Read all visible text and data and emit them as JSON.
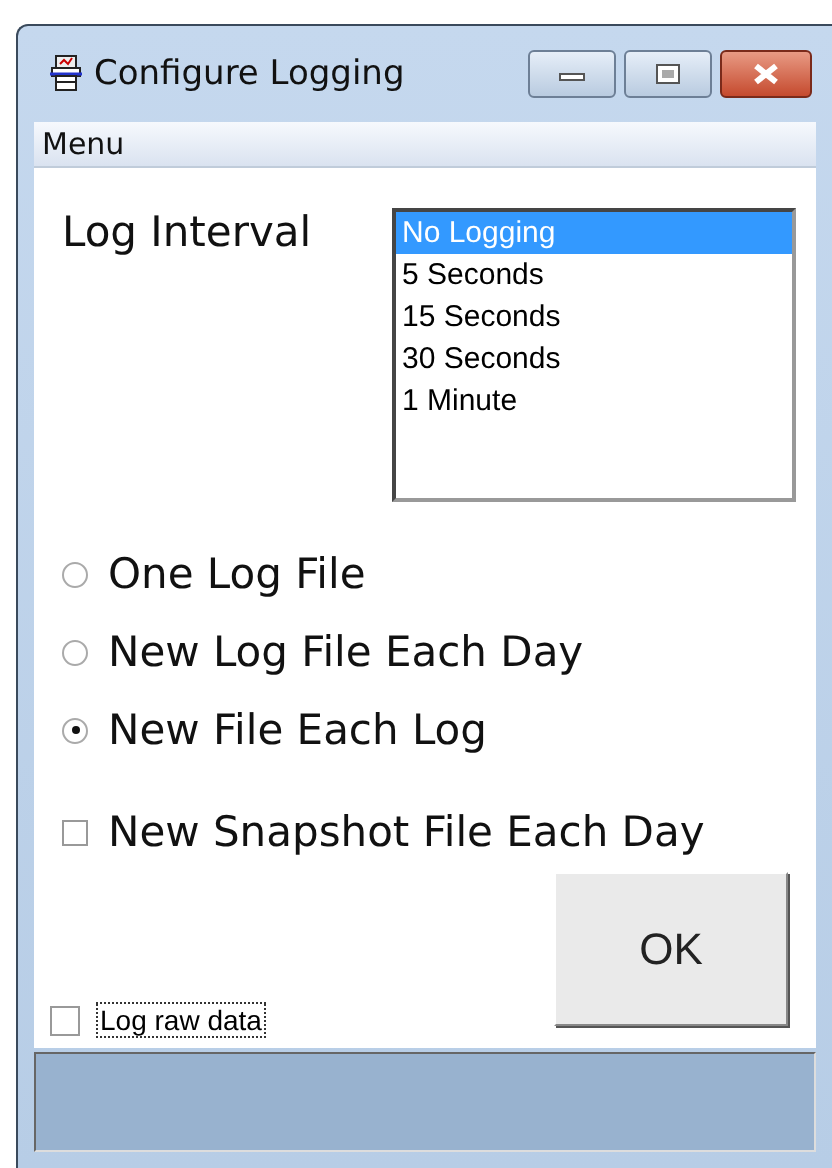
{
  "window": {
    "title": "Configure Logging"
  },
  "menu": [
    "Menu"
  ],
  "log_interval": {
    "label": "Log Interval",
    "options": [
      {
        "label": "No Logging",
        "selected": true
      },
      {
        "label": "5 Seconds",
        "selected": false
      },
      {
        "label": "15 Seconds",
        "selected": false
      },
      {
        "label": "30 Seconds",
        "selected": false
      },
      {
        "label": "1 Minute",
        "selected": false
      }
    ]
  },
  "file_mode": [
    {
      "label": "One Log File",
      "selected": false
    },
    {
      "label": "New Log File Each Day",
      "selected": false
    },
    {
      "label": "New File Each Log",
      "selected": true
    }
  ],
  "snapshot": {
    "label": "New Snapshot File Each Day",
    "checked": false
  },
  "ok_button": "OK",
  "raw_data": {
    "label": "Log raw data",
    "checked": false
  }
}
